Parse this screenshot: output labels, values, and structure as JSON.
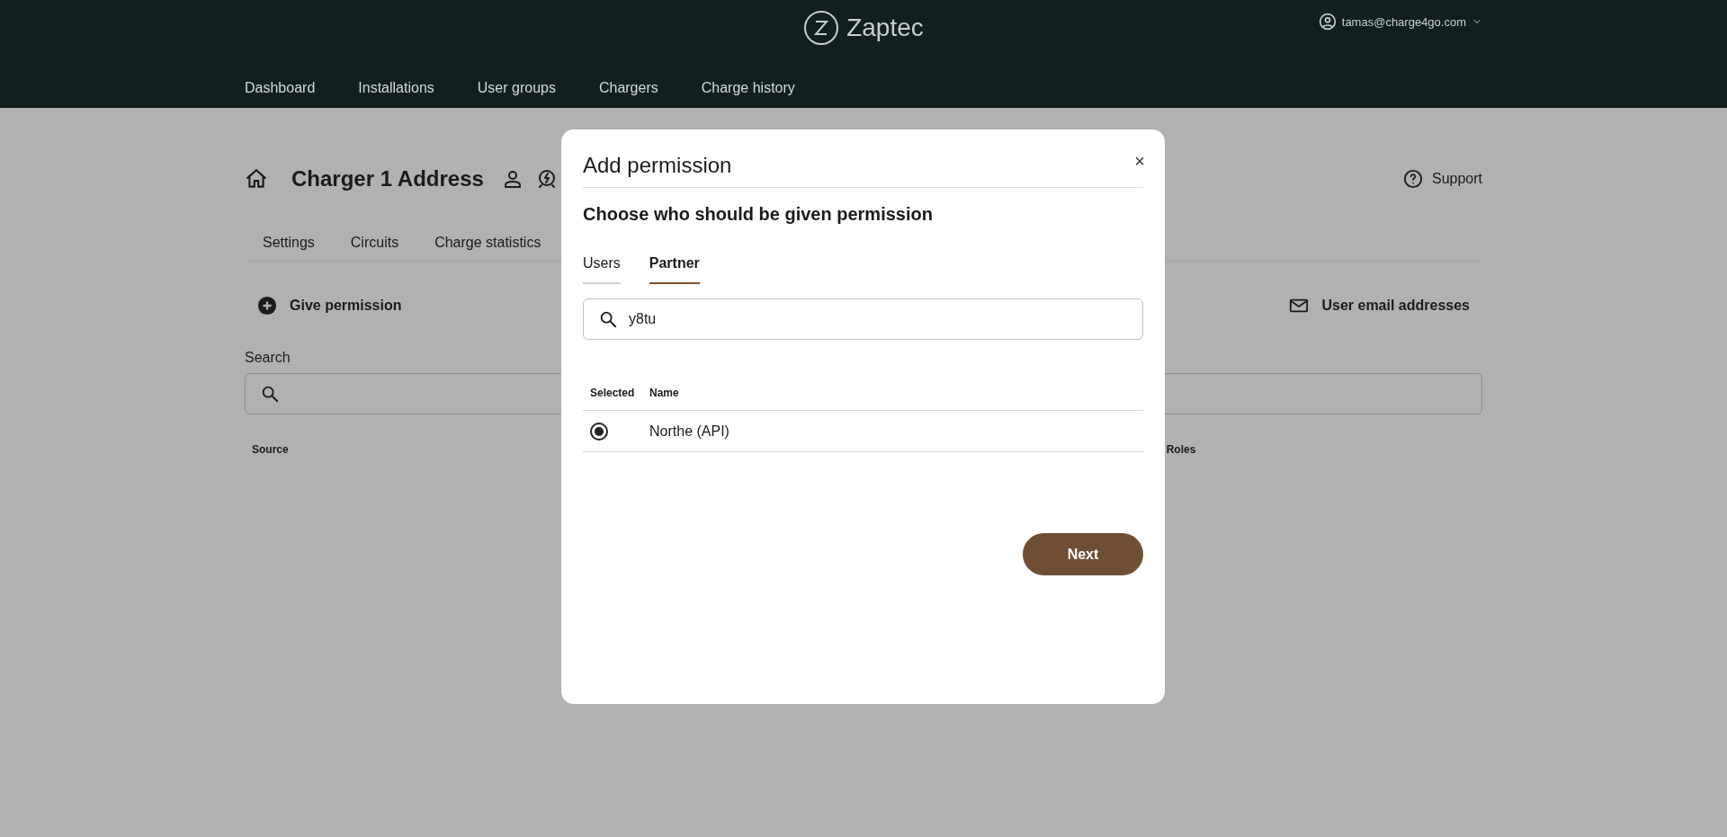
{
  "header": {
    "brand": "Zaptec",
    "account": "tamas@charge4go.com",
    "nav": [
      {
        "label": "Dashboard"
      },
      {
        "label": "Installations"
      },
      {
        "label": "User groups"
      },
      {
        "label": "Chargers"
      },
      {
        "label": "Charge history"
      }
    ]
  },
  "page": {
    "title": "Charger 1 Address",
    "support": "Support",
    "tabs": [
      {
        "label": "Settings"
      },
      {
        "label": "Circuits"
      },
      {
        "label": "Charge statistics"
      }
    ],
    "give_permission": "Give permission",
    "user_emails": "User email addresses",
    "search_label": "Search",
    "columns": [
      "Source",
      "Roles"
    ]
  },
  "dialog": {
    "title": "Add permission",
    "close": "×",
    "heading": "Choose who should be given permission",
    "tabs": [
      {
        "label": "Users",
        "selected": false
      },
      {
        "label": "Partner",
        "selected": true
      }
    ],
    "search": {
      "value": "y8tu"
    },
    "columns": [
      "Selected",
      "Name"
    ],
    "rows": [
      {
        "name": "Northe (API)",
        "selected": true
      }
    ],
    "next": "Next"
  }
}
